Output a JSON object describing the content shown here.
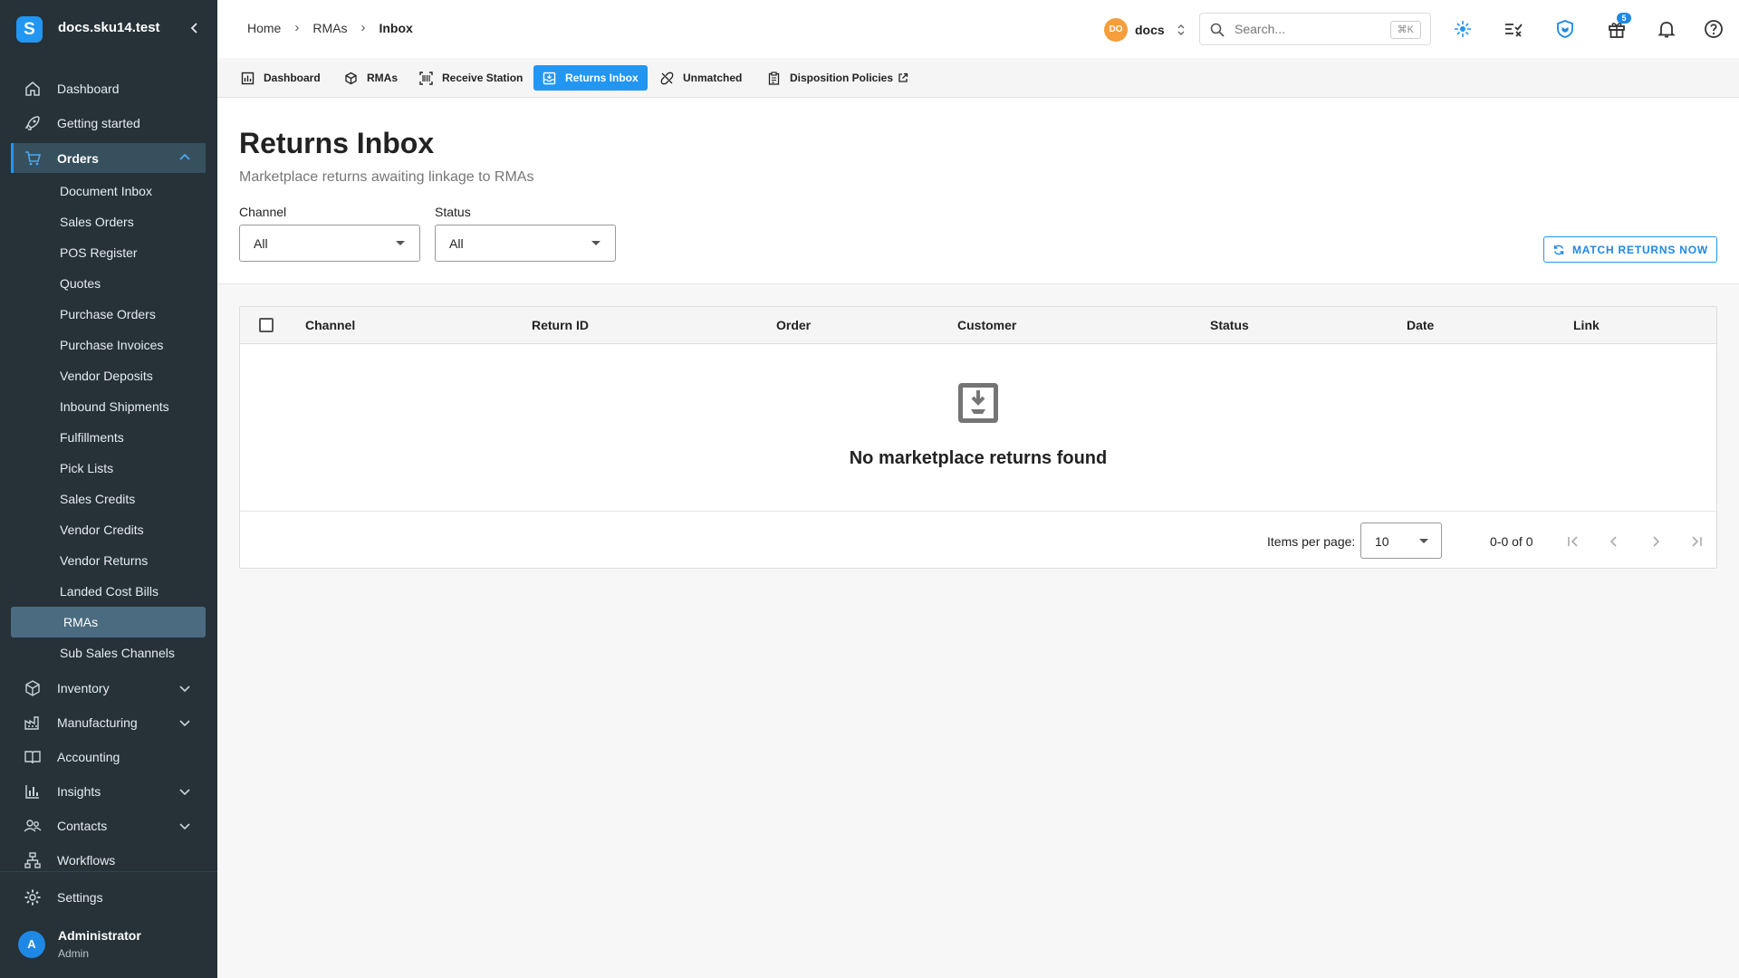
{
  "app": {
    "title": "docs.sku14.test",
    "logo_letter": "S"
  },
  "sidebar": {
    "items": [
      {
        "label": "Dashboard",
        "icon": "home-icon"
      },
      {
        "label": "Getting started",
        "icon": "rocket-icon"
      },
      {
        "label": "Orders",
        "icon": "cart-icon",
        "expanded": true
      },
      {
        "label": "Inventory",
        "icon": "box-icon"
      },
      {
        "label": "Manufacturing",
        "icon": "factory-icon"
      },
      {
        "label": "Accounting",
        "icon": "book-icon"
      },
      {
        "label": "Insights",
        "icon": "bar-chart-icon"
      },
      {
        "label": "Contacts",
        "icon": "people-icon"
      },
      {
        "label": "Workflows",
        "icon": "workflow-icon"
      },
      {
        "label": "Settings",
        "icon": "gear-icon"
      }
    ],
    "orders_sub": [
      "Document Inbox",
      "Sales Orders",
      "POS Register",
      "Quotes",
      "Purchase Orders",
      "Purchase Invoices",
      "Vendor Deposits",
      "Inbound Shipments",
      "Fulfillments",
      "Pick Lists",
      "Sales Credits",
      "Vendor Credits",
      "Vendor Returns",
      "Landed Cost Bills",
      "RMAs",
      "Sub Sales Channels"
    ],
    "selected_sub": "RMAs",
    "user": {
      "initial": "A",
      "name": "Administrator",
      "role": "Admin"
    }
  },
  "header": {
    "breadcrumb": [
      "Home",
      "RMAs",
      "Inbox"
    ],
    "workspace": {
      "initials": "DO",
      "name": "docs"
    },
    "search": {
      "placeholder": "Search...",
      "shortcut": "⌘K"
    },
    "notification_count": "5"
  },
  "tabs": [
    {
      "label": "Dashboard",
      "icon": "dashboard-icon"
    },
    {
      "label": "RMAs",
      "icon": "package-return-icon"
    },
    {
      "label": "Receive Station",
      "icon": "scanner-icon"
    },
    {
      "label": "Returns Inbox",
      "icon": "inbox-icon",
      "active": true
    },
    {
      "label": "Unmatched",
      "icon": "unlink-icon"
    },
    {
      "label": "Disposition Policies",
      "icon": "clipboard-icon",
      "external": true
    }
  ],
  "page": {
    "title": "Returns Inbox",
    "subtitle": "Marketplace returns awaiting linkage to RMAs",
    "filters": {
      "channel": {
        "label": "Channel",
        "value": "All"
      },
      "status": {
        "label": "Status",
        "value": "All"
      }
    },
    "match_button": "MATCH RETURNS NOW"
  },
  "table": {
    "columns": [
      "Channel",
      "Return ID",
      "Order",
      "Customer",
      "Status",
      "Date",
      "Link"
    ],
    "rows": [],
    "empty_text": "No marketplace returns found",
    "items_per_page_label": "Items per page:",
    "items_per_page": "10",
    "range": "0-0 of 0"
  },
  "colors": {
    "accent": "#2196f3",
    "sidebar_bg": "#263238",
    "workspace_badge": "#f59e3b"
  }
}
